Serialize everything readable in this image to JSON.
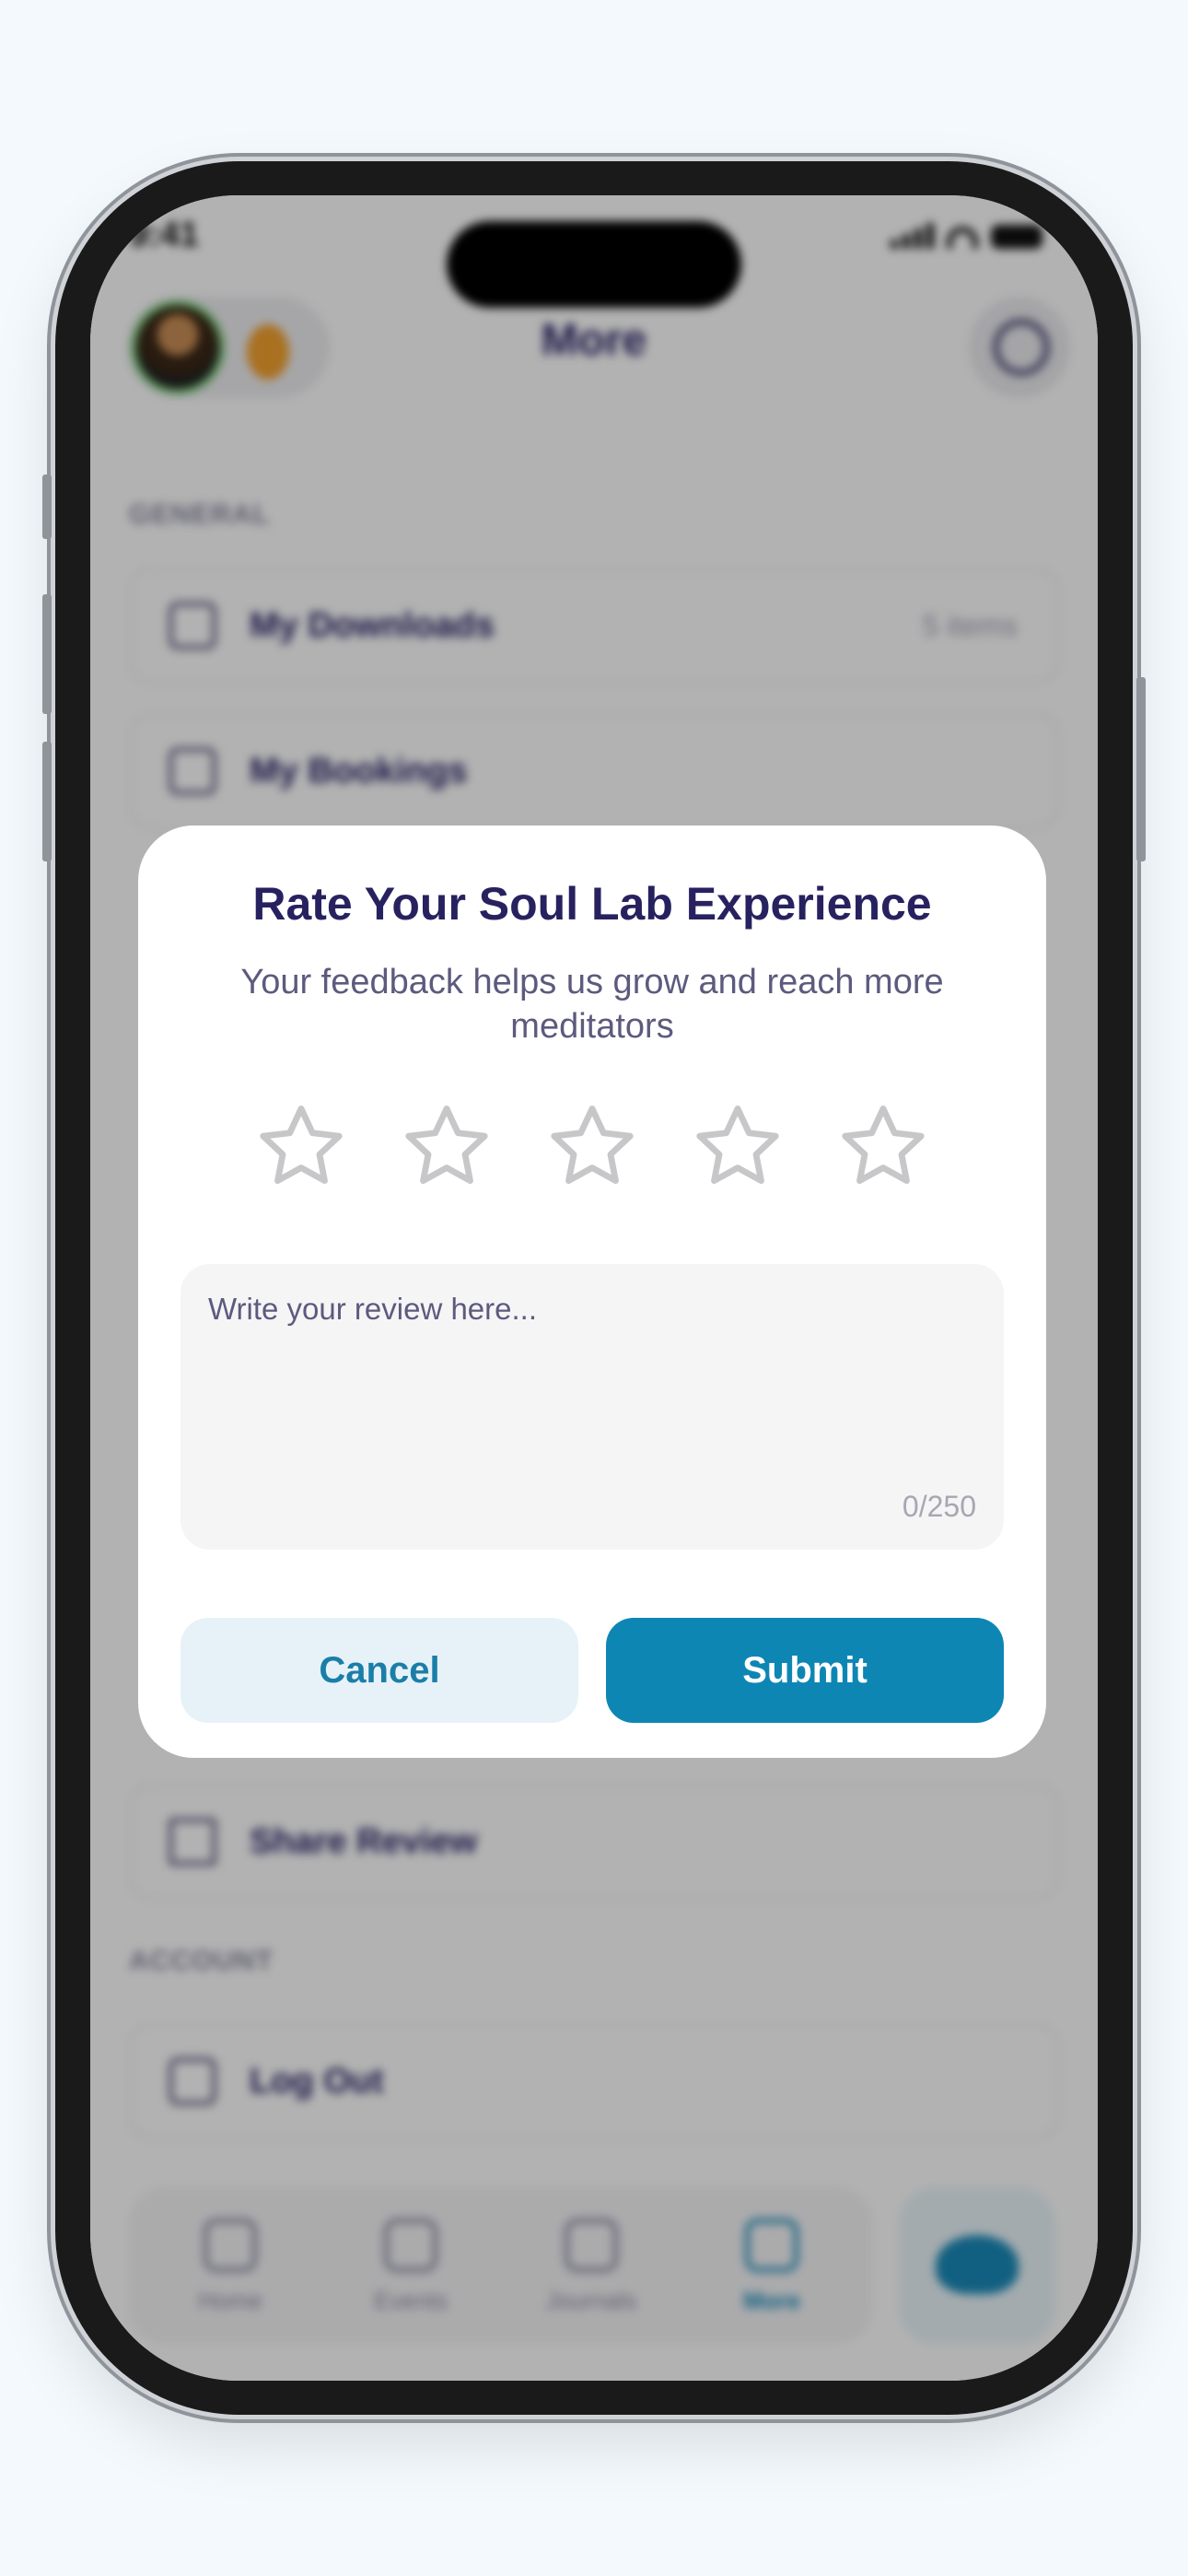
{
  "status_bar": {
    "time": "9:41"
  },
  "header": {
    "title": "More",
    "avatar_icon": "user-avatar",
    "coin_icon": "coin-icon",
    "search_icon": "search-icon"
  },
  "sections": {
    "general": {
      "label": "GENERAL",
      "items": [
        {
          "label": "My Downloads",
          "meta": "5 items",
          "icon": "download-icon"
        },
        {
          "label": "My Bookings",
          "meta": "",
          "icon": "calendar-icon"
        }
      ]
    },
    "share": {
      "item_label": "Share Review",
      "icon": "star-icon"
    },
    "account": {
      "label": "ACCOUNT",
      "item_label": "Log Out",
      "icon": "logout-icon"
    }
  },
  "tabbar": {
    "tabs": [
      {
        "label": "Home",
        "icon": "home-icon"
      },
      {
        "label": "Events",
        "icon": "calendar-icon"
      },
      {
        "label": "Journals",
        "icon": "journal-edit-icon"
      },
      {
        "label": "More",
        "icon": "menu-icon",
        "active": true
      }
    ],
    "center_icon": "lotus-icon"
  },
  "modal": {
    "title": "Rate Your Soul Lab Experience",
    "subtitle": "Your feedback helps us grow and reach more meditators",
    "rating": {
      "value": 0,
      "max": 5
    },
    "review": {
      "placeholder": "Write your review here...",
      "value": "",
      "char_count": "0/250"
    },
    "cancel_label": "Cancel",
    "submit_label": "Submit"
  },
  "colors": {
    "page_background": "#f4f9fd",
    "title": "#27225f",
    "subtitle": "#5d5a7e",
    "primary": "#0e86b4",
    "cancel_background": "#e6f2f8",
    "star_outline": "#c7c7c9",
    "dim_overlay": "rgba(0,0,0,0.30)"
  }
}
